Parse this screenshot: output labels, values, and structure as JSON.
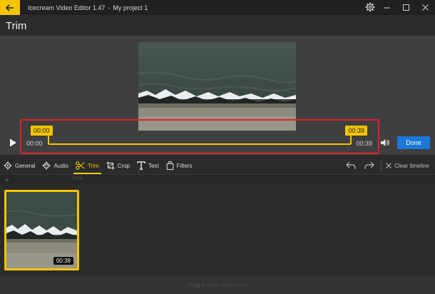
{
  "titlebar": {
    "app_name": "Icecream Video Editor 1.47",
    "separator": "-",
    "project_name": "My project 1"
  },
  "page": {
    "title": "Trim"
  },
  "trim": {
    "start_handle": "00:00",
    "end_handle": "00:39",
    "time_start": "00:00",
    "time_end": "00:39",
    "done_label": "Done"
  },
  "toolbar": {
    "tools": [
      {
        "id": "general",
        "label": "General",
        "icon": "gear-icon"
      },
      {
        "id": "audio",
        "label": "Audio",
        "icon": "audio-gear-icon"
      },
      {
        "id": "trim",
        "label": "Trim",
        "icon": "scissors-icon",
        "active": true
      },
      {
        "id": "crop",
        "label": "Crop",
        "icon": "crop-icon"
      },
      {
        "id": "text",
        "label": "Text",
        "icon": "text-icon"
      },
      {
        "id": "filters",
        "label": "Filters",
        "icon": "filters-icon"
      }
    ],
    "clear_timeline": "Clear timeline"
  },
  "timeline": {
    "ruler_label": "00:00",
    "clip_duration": "00:39",
    "audio_drop_text": "Drag & drop audio here"
  },
  "colors": {
    "accent": "#f5c400",
    "done_button": "#1a78d8",
    "highlight_box": "#d9252a"
  }
}
